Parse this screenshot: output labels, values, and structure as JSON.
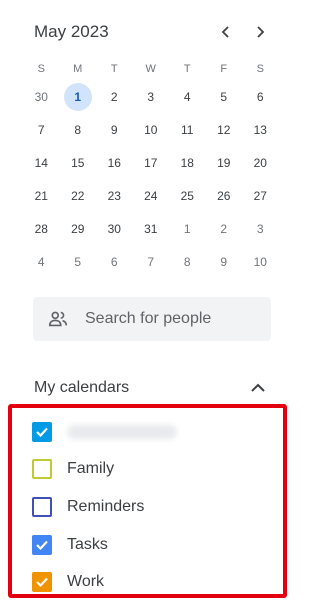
{
  "mini_calendar": {
    "month_label": "May 2023",
    "weekdays": [
      "S",
      "M",
      "T",
      "W",
      "T",
      "F",
      "S"
    ],
    "weeks": [
      [
        {
          "d": "30",
          "m": true
        },
        {
          "d": "1",
          "today": true
        },
        {
          "d": "2"
        },
        {
          "d": "3"
        },
        {
          "d": "4"
        },
        {
          "d": "5"
        },
        {
          "d": "6"
        }
      ],
      [
        {
          "d": "7"
        },
        {
          "d": "8"
        },
        {
          "d": "9"
        },
        {
          "d": "10"
        },
        {
          "d": "11"
        },
        {
          "d": "12"
        },
        {
          "d": "13"
        }
      ],
      [
        {
          "d": "14"
        },
        {
          "d": "15"
        },
        {
          "d": "16"
        },
        {
          "d": "17"
        },
        {
          "d": "18"
        },
        {
          "d": "19"
        },
        {
          "d": "20"
        }
      ],
      [
        {
          "d": "21"
        },
        {
          "d": "22"
        },
        {
          "d": "23"
        },
        {
          "d": "24"
        },
        {
          "d": "25"
        },
        {
          "d": "26"
        },
        {
          "d": "27"
        }
      ],
      [
        {
          "d": "28"
        },
        {
          "d": "29"
        },
        {
          "d": "30"
        },
        {
          "d": "31"
        },
        {
          "d": "1",
          "m": true
        },
        {
          "d": "2",
          "m": true
        },
        {
          "d": "3",
          "m": true
        }
      ],
      [
        {
          "d": "4",
          "m": true
        },
        {
          "d": "5",
          "m": true
        },
        {
          "d": "6",
          "m": true
        },
        {
          "d": "7",
          "m": true
        },
        {
          "d": "8",
          "m": true
        },
        {
          "d": "9",
          "m": true
        },
        {
          "d": "10",
          "m": true
        }
      ]
    ],
    "prev_icon": "chevron-left-icon",
    "next_icon": "chevron-right-icon"
  },
  "search": {
    "placeholder": "Search for people",
    "icon": "people-icon"
  },
  "my_calendars": {
    "title": "My calendars",
    "collapse_icon": "chevron-up-icon",
    "items": [
      {
        "label": "",
        "redacted": true,
        "checked": true,
        "color": "#039be5"
      },
      {
        "label": "Family",
        "checked": false,
        "color": "#c0ca33"
      },
      {
        "label": "Reminders",
        "checked": false,
        "color": "#3f51b5"
      },
      {
        "label": "Tasks",
        "checked": true,
        "color": "#4285f4"
      },
      {
        "label": "Work",
        "checked": true,
        "color": "#f09300"
      }
    ]
  },
  "colors": {
    "today_bg": "#d2e3fc",
    "today_text": "#185abc",
    "highlight_border": "#e3000f"
  }
}
